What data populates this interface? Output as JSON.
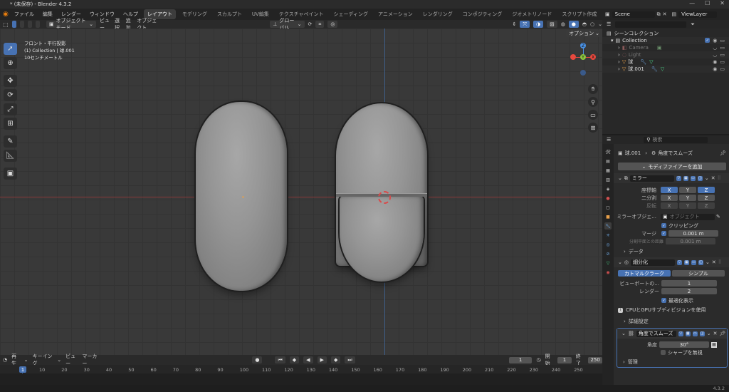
{
  "titlebar": {
    "title": "* (未保存) - Blender 4.3.2"
  },
  "menu": {
    "items": [
      "ファイル",
      "編集",
      "レンダー",
      "ウィンドウ",
      "ヘルプ"
    ],
    "workspaces": [
      "レイアウト",
      "モデリング",
      "スカルプト",
      "UV編集",
      "テクスチャペイント",
      "シェーディング",
      "アニメーション",
      "レンダリング",
      "コンポジティング",
      "ジオメトリノード",
      "スクリプト作成"
    ],
    "add_tab": "+"
  },
  "viewport": {
    "mode": "オブジェクトモード",
    "menus": [
      "ビュー",
      "選択",
      "追加",
      "オブジェクト"
    ],
    "transform": "グローバル",
    "options": "オプション",
    "info": {
      "line1": "フロント・平行投影",
      "line2": "(1) Collection | 球.001",
      "line3": "10センチメートル"
    },
    "gizmo": {
      "x": "X",
      "y": "Y",
      "z": "Z"
    }
  },
  "timeline": {
    "menus": [
      "再生",
      "キーイング",
      "ビュー",
      "マーカー"
    ],
    "current_frame": "1",
    "start_label": "開始",
    "start": "1",
    "end_label": "終了",
    "end": "250",
    "ruler": [
      "10",
      "20",
      "30",
      "40",
      "50",
      "60",
      "70",
      "80",
      "90",
      "100",
      "110",
      "120",
      "130",
      "140",
      "150",
      "160",
      "170",
      "180",
      "190",
      "200",
      "210",
      "220",
      "230",
      "240",
      "250"
    ],
    "ruler_current": "1"
  },
  "status": {
    "version": "4.3.2"
  },
  "topright": {
    "scene": "Scene",
    "viewlayer": "ViewLayer"
  },
  "outliner": {
    "scene_collection": "シーンコレクション",
    "collection": "Collection",
    "items": [
      {
        "name": "Camera",
        "hidden": true
      },
      {
        "name": "Light",
        "hidden": true
      },
      {
        "name": "球",
        "hidden": false
      },
      {
        "name": "球.001",
        "hidden": false
      }
    ]
  },
  "properties": {
    "search_placeholder": "検索",
    "breadcrumb_object": "球.001",
    "breadcrumb_modifier": "角度でスムーズ",
    "add_modifier": "モディファイアーを追加",
    "mirror": {
      "name": "ミラー",
      "axis_label": "座標軸",
      "bisect_label": "二分割",
      "flip_label": "反転",
      "x": "X",
      "y": "Y",
      "z": "Z",
      "mirror_object_label": "ミラーオブジェ...",
      "mirror_object_placeholder": "オブジェクト",
      "clipping_label": "クリッピング",
      "merge_label": "マージ",
      "merge_value": "0.001 m",
      "bisect_distance_label": "分割平面との距離",
      "bisect_distance_value": "0.001 m",
      "data_label": "データ"
    },
    "subsurf": {
      "name": "細分化",
      "catmull": "カトマルクラーク",
      "simple": "シンプル",
      "viewport_label": "ビューポートの...",
      "viewport_value": "1",
      "render_label": "レンダー",
      "render_value": "2",
      "optimal_label": "最適化表示",
      "gpu_note": "CPUとGPUサブディビジョンを使用",
      "advanced_label": "詳細設定"
    },
    "smooth": {
      "name": "角度でスムーズ",
      "angle_label": "角度",
      "angle_value": "30°",
      "ignore_sharp_label": "シャープを無視",
      "manage_label": "管理"
    }
  },
  "colors": {
    "accent": "#4772b3",
    "header": "#2a2a2a",
    "viewport": "#393939",
    "x_axis": "#e8493e",
    "y_axis": "#8cc63f",
    "z_axis": "#4a90e2"
  }
}
